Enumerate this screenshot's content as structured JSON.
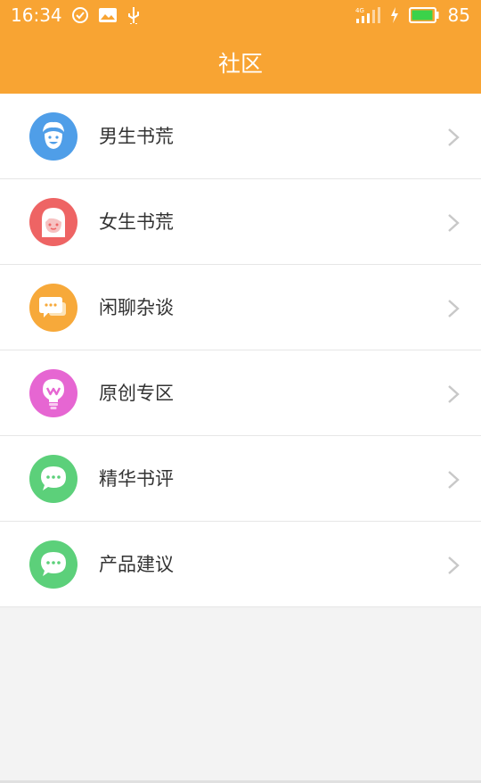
{
  "status_bar": {
    "time": "16:34",
    "network": "4G",
    "battery_level": "85"
  },
  "header": {
    "title": "社区",
    "background": "#f8a433"
  },
  "rows": [
    {
      "label": "男生书荒",
      "icon": "boy-face-icon",
      "color": "#4f9ee8"
    },
    {
      "label": "女生书荒",
      "icon": "girl-face-icon",
      "color": "#ee6464"
    },
    {
      "label": "闲聊杂谈",
      "icon": "chat-bubbles-icon",
      "color": "#f7a93a"
    },
    {
      "label": "原创专区",
      "icon": "lightbulb-icon",
      "color": "#e666d2"
    },
    {
      "label": "精华书评",
      "icon": "chat-bubble-icon",
      "color": "#5cd07a"
    },
    {
      "label": "产品建议",
      "icon": "chat-bubble-icon",
      "color": "#5cd07a"
    }
  ]
}
